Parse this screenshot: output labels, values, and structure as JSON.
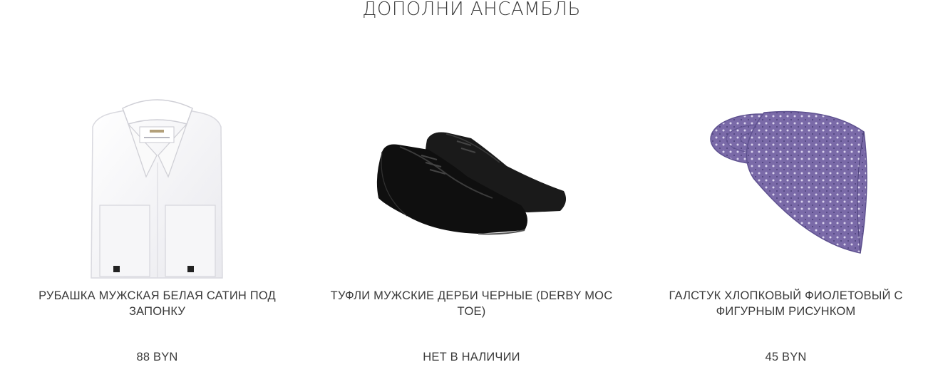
{
  "section": {
    "title": "ДОПОЛНИ АНСАМБЛЬ"
  },
  "products": [
    {
      "name": "РУБАШКА МУЖСКАЯ БЕЛАЯ САТИН ПОД ЗАПОНКУ",
      "price": "88 BYN",
      "image_icon": "shirt-icon"
    },
    {
      "name": "ТУФЛИ МУЖСКИЕ ДЕРБИ ЧЕРНЫЕ (DERBY MOC TOE)",
      "price": "НЕТ В НАЛИЧИИ",
      "image_icon": "shoes-icon"
    },
    {
      "name": "ГАЛСТУК ХЛОПКОВЫЙ ФИОЛЕТОВЫЙ С ФИГУРНЫМ РИСУНКОМ",
      "price": "45 BYN",
      "image_icon": "tie-icon"
    }
  ],
  "colors": {
    "text": "#3a3a3a",
    "tie": "#7a6aa8",
    "shoe": "#141414"
  }
}
